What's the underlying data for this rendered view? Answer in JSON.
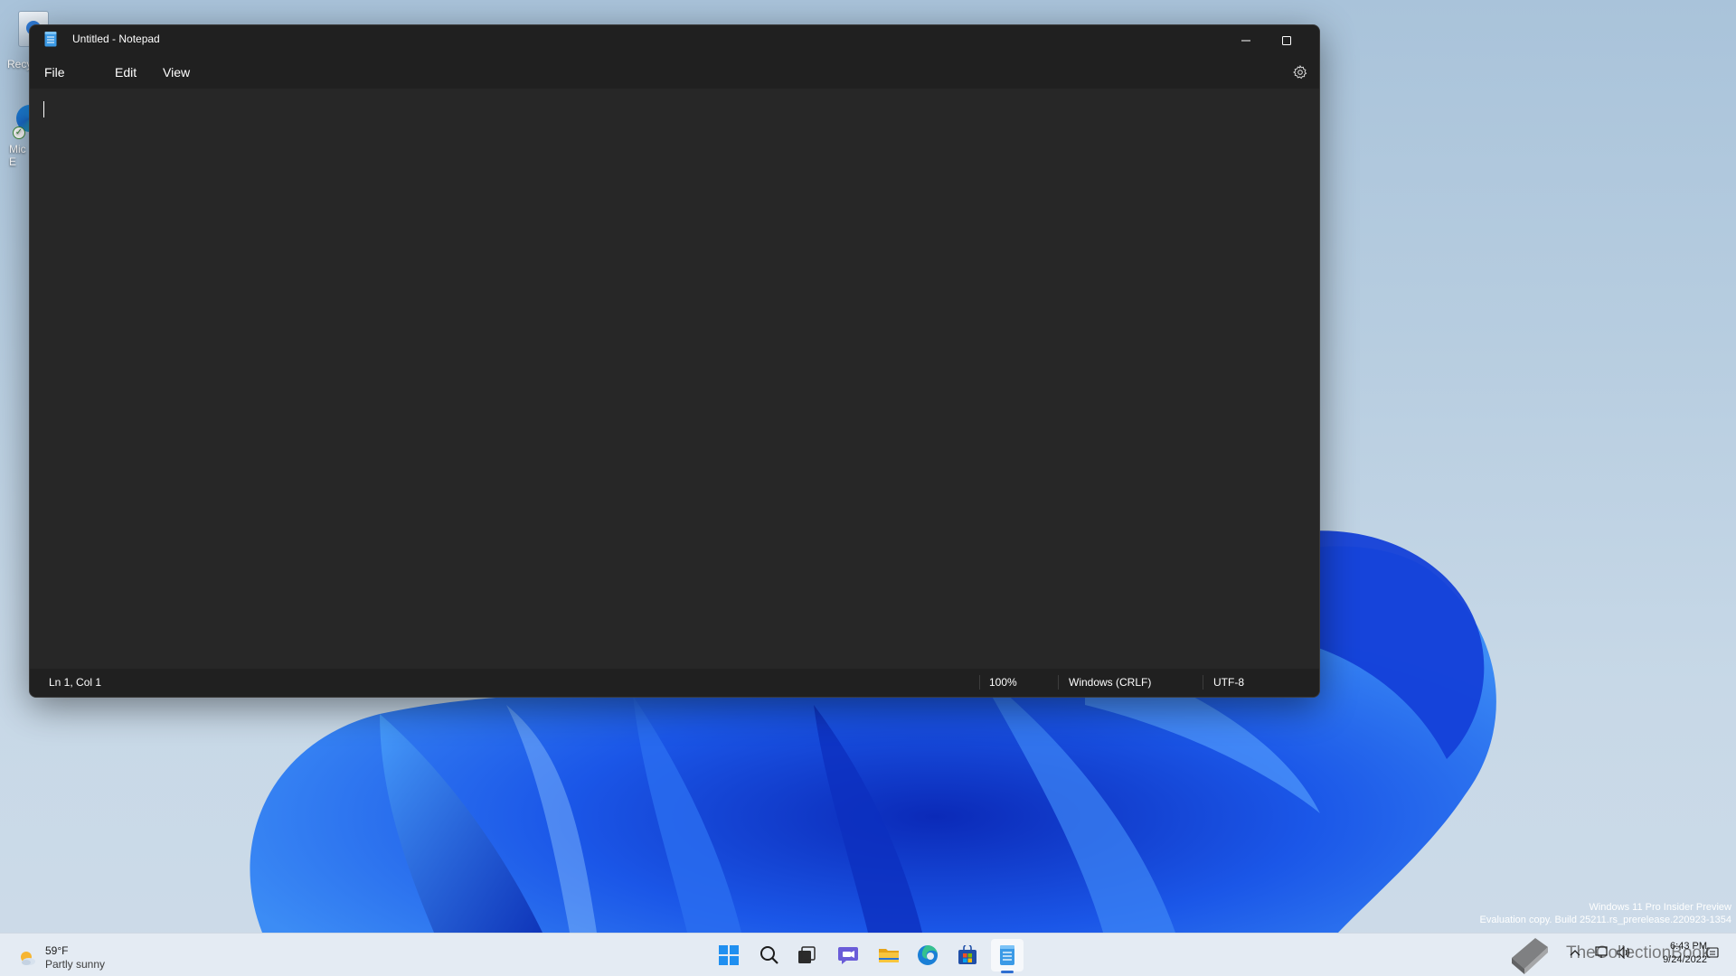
{
  "desktop": {
    "icons": [
      {
        "label": "Recy"
      },
      {
        "label": "Mic\nE"
      }
    ]
  },
  "window": {
    "title": "Untitled - Notepad",
    "menu": {
      "file": "File",
      "edit": "Edit",
      "view": "View"
    },
    "editor": {
      "content": ""
    },
    "status": {
      "position": "Ln 1, Col 1",
      "zoom": "100%",
      "line_ending": "Windows (CRLF)",
      "encoding": "UTF-8"
    }
  },
  "watermark": {
    "line1": "Windows 11 Pro Insider Preview",
    "line2": "Evaluation copy. Build 25211.rs_prerelease.220923-1354"
  },
  "taskbar": {
    "weather": {
      "temperature": "59°F",
      "condition": "Partly sunny"
    },
    "apps": [
      "start-icon",
      "search-icon",
      "task-view-icon",
      "chat-icon",
      "file-explorer-icon",
      "edge-icon",
      "store-icon",
      "notepad-icon"
    ],
    "tray_overlay_text": "TheCollectionBook",
    "clock": {
      "time": "6:43 PM",
      "date": "9/24/2022"
    }
  },
  "colors": {
    "window_bg": "#272727",
    "titlebar_bg": "#202020",
    "taskbar_bg": "#e4ebf3",
    "accent": "#2f6fd1"
  }
}
